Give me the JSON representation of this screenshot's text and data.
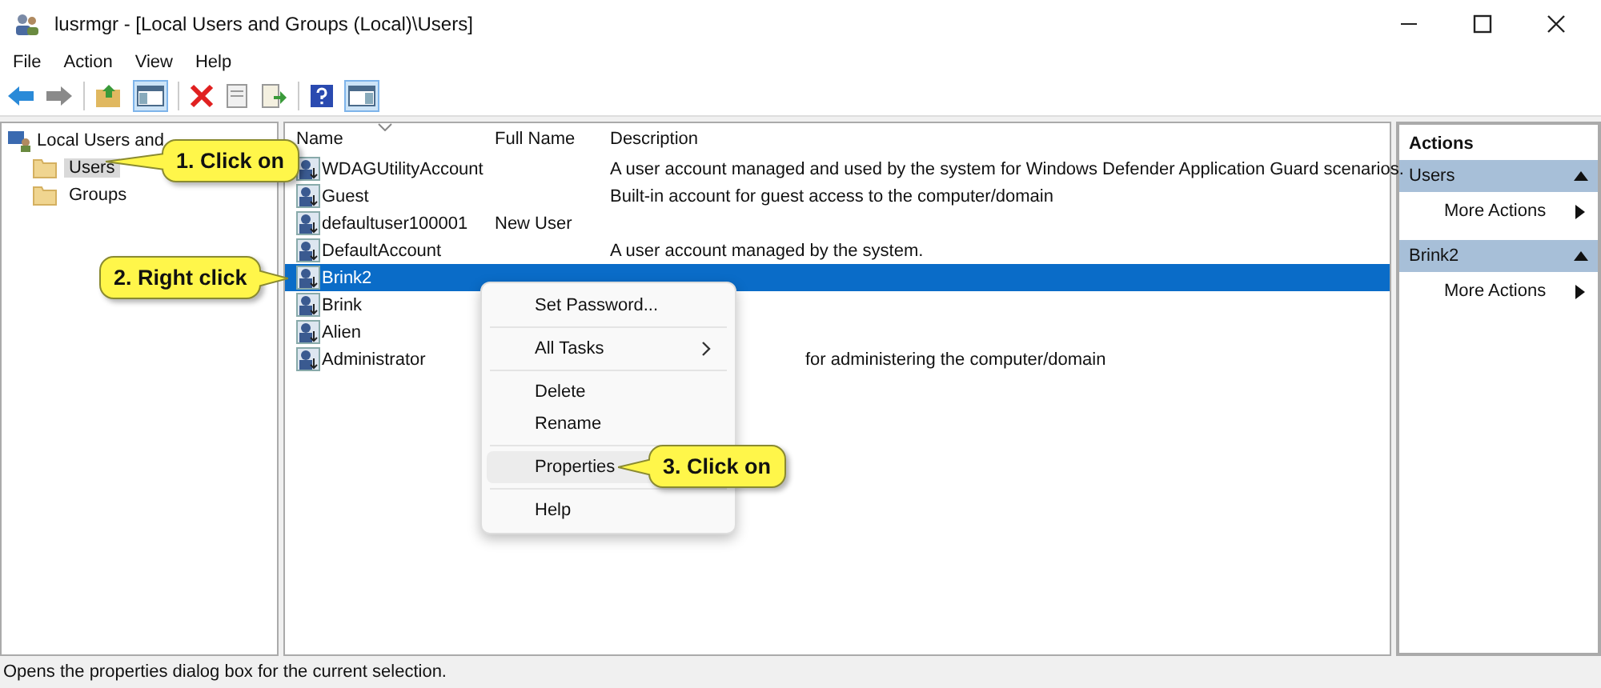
{
  "window": {
    "title": "lusrmgr - [Local Users and Groups (Local)\\Users]"
  },
  "menu_bar": [
    "File",
    "Action",
    "View",
    "Help"
  ],
  "tree": {
    "root": "Local Users and",
    "children": [
      {
        "label": "Users",
        "selected": true
      },
      {
        "label": "Groups",
        "selected": false
      }
    ]
  },
  "table": {
    "columns": [
      "Name",
      "Full Name",
      "Description"
    ],
    "rows": [
      {
        "name": "WDAGUtilityAccount",
        "full_name": "",
        "description": "A user account managed and used by the system for Windows Defender Application Guard scenarios.",
        "selected": false
      },
      {
        "name": "Guest",
        "full_name": "",
        "description": "Built-in account for guest access to the computer/domain",
        "selected": false
      },
      {
        "name": "defaultuser100001",
        "full_name": "New User",
        "description": "",
        "selected": false
      },
      {
        "name": "DefaultAccount",
        "full_name": "",
        "description": "A user account managed by the system.",
        "selected": false
      },
      {
        "name": "Brink2",
        "full_name": "",
        "description": "",
        "selected": true
      },
      {
        "name": "Brink",
        "full_name": "",
        "description": "",
        "selected": false
      },
      {
        "name": "Alien",
        "full_name": "",
        "description": "",
        "selected": false
      },
      {
        "name": "Administrator",
        "full_name": "",
        "description": "for administering the computer/domain",
        "selected": false,
        "covered_by_menu": true
      }
    ]
  },
  "context_menu": [
    {
      "label": "Set Password...",
      "submenu": false,
      "hovered": false,
      "divider_after": true
    },
    {
      "label": "All Tasks",
      "submenu": true,
      "hovered": false,
      "divider_after": true
    },
    {
      "label": "Delete",
      "submenu": false,
      "hovered": false,
      "divider_after": false
    },
    {
      "label": "Rename",
      "submenu": false,
      "hovered": false,
      "divider_after": true
    },
    {
      "label": "Properties",
      "submenu": false,
      "hovered": true,
      "divider_after": true
    },
    {
      "label": "Help",
      "submenu": false,
      "hovered": false,
      "divider_after": false
    }
  ],
  "actions": {
    "title": "Actions",
    "sections": [
      {
        "title": "Users",
        "items": [
          "More Actions"
        ]
      },
      {
        "title": "Brink2",
        "items": [
          "More Actions"
        ]
      }
    ]
  },
  "callouts": [
    "1. Click on",
    "2. Right click",
    "3. Click on"
  ],
  "status_bar": "Opens the properties dialog box for the current selection."
}
